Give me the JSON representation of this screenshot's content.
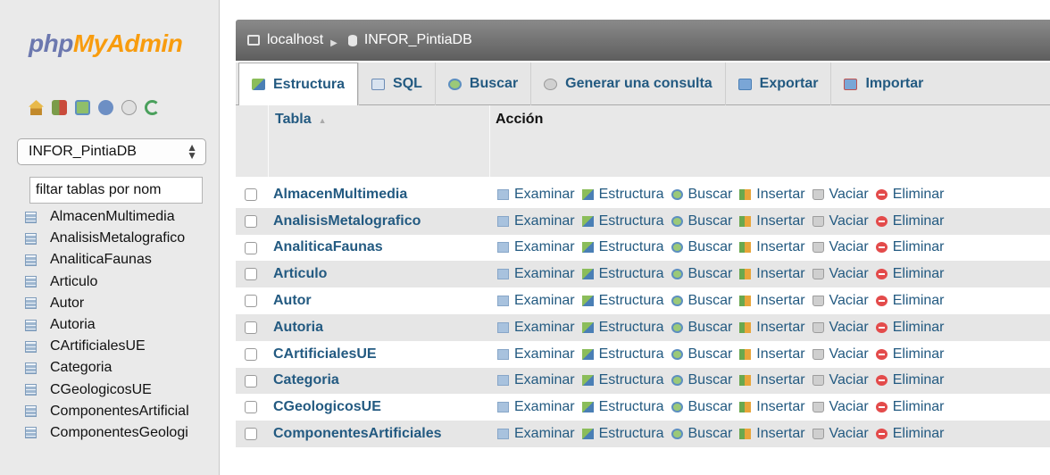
{
  "logo": {
    "part1": "php",
    "part2": "MyAdmin"
  },
  "nav": {
    "icons": [
      "home-icon",
      "exit-icon",
      "sql-query-icon",
      "docs-icon",
      "settings-icon",
      "reload-icon"
    ],
    "database_select": "INFOR_PintiaDB",
    "filter_placeholder": "filtar tablas por nom",
    "tables": [
      "AlmacenMultimedia",
      "AnalisisMetalografico",
      "AnaliticaFaunas",
      "Articulo",
      "Autor",
      "Autoria",
      "CArtificialesUE",
      "Categoria",
      "CGeologicosUE",
      "ComponentesArtificial",
      "ComponentesGeologi"
    ]
  },
  "breadcrumb": {
    "server": "localhost",
    "database": "INFOR_PintiaDB"
  },
  "tabs": [
    {
      "label": "Estructura",
      "icon": "structure-icon",
      "active": true
    },
    {
      "label": "SQL",
      "icon": "sql-icon",
      "active": false
    },
    {
      "label": "Buscar",
      "icon": "search-icon",
      "active": false
    },
    {
      "label": "Generar una consulta",
      "icon": "query-icon",
      "active": false
    },
    {
      "label": "Exportar",
      "icon": "export-icon",
      "active": false
    },
    {
      "label": "Importar",
      "icon": "import-icon",
      "active": false
    }
  ],
  "table_header": {
    "tabla": "Tabla",
    "accion": "Acción"
  },
  "actions": {
    "browse": "Examinar",
    "structure": "Estructura",
    "search": "Buscar",
    "insert": "Insertar",
    "empty": "Vaciar",
    "drop": "Eliminar"
  },
  "rows": [
    "AlmacenMultimedia",
    "AnalisisMetalografico",
    "AnaliticaFaunas",
    "Articulo",
    "Autor",
    "Autoria",
    "CArtificialesUE",
    "Categoria",
    "CGeologicosUE",
    "ComponentesArtificiales"
  ],
  "colors": {
    "link": "#235a81",
    "logo_php": "#6c78af",
    "logo_myadmin": "#f89c0e"
  }
}
